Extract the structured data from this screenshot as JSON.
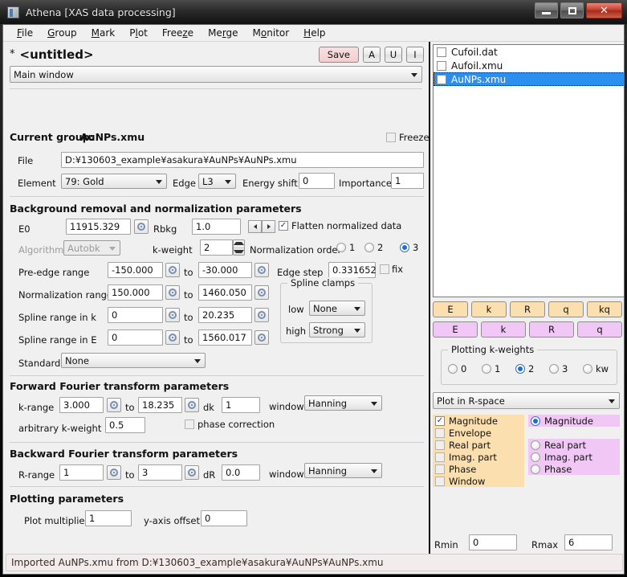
{
  "window": {
    "title": "Athena [XAS data processing]",
    "icon": "app-icon",
    "minimize": "–",
    "maximize": "□",
    "close": "✕"
  },
  "menubar": [
    {
      "label": "File"
    },
    {
      "label": "Group"
    },
    {
      "label": "Mark"
    },
    {
      "label": "Plot"
    },
    {
      "label": "Freeze"
    },
    {
      "label": "Merge"
    },
    {
      "label": "Monitor"
    },
    {
      "label": "Help"
    }
  ],
  "header": {
    "modified_marker": "*",
    "project_title": "<untitled>",
    "save_label": "Save",
    "a_label": "A",
    "u_label": "U",
    "i_label": "I",
    "view_combo": "Main window"
  },
  "current_group": {
    "label": "Current group:",
    "name": "AuNPs.xmu",
    "freeze_label": "Freeze",
    "freeze_checked": false,
    "file_label": "File",
    "file_value": "D:¥130603_example¥asakura¥AuNPs¥AuNPs.xmu",
    "element_label": "Element",
    "element_value": "79: Gold",
    "edge_label": "Edge",
    "edge_value": "L3",
    "energy_shift_label": "Energy shift",
    "energy_shift_value": "0",
    "importance_label": "Importance",
    "importance_value": "1"
  },
  "background": {
    "section_title": "Background removal and normalization parameters",
    "e0_label": "E0",
    "e0_value": "11915.329",
    "rbkg_label": "Rbkg",
    "rbkg_value": "1.0",
    "flatten_label": "Flatten normalized data",
    "flatten_checked": true,
    "algorithm_label": "Algorithm",
    "algorithm_value": "Autobk",
    "kweight_label": "k-weight",
    "kweight_value": "2",
    "norm_order_label": "Normalization order",
    "norm_order_options": [
      "1",
      "2",
      "3"
    ],
    "norm_order_selected": "3",
    "preedge_label": "Pre-edge range",
    "preedge_from": "-150.000",
    "preedge_to": "-30.000",
    "norm_label": "Normalization range",
    "norm_from": "150.000",
    "norm_to": "1460.050",
    "spline_k_label": "Spline range in k",
    "spline_k_from": "0",
    "spline_k_to": "20.235",
    "spline_e_label": "Spline range in E",
    "spline_e_from": "0",
    "spline_e_to": "1560.017",
    "to_label": "to",
    "edge_step_label": "Edge step",
    "edge_step_value": "0.331652",
    "fix_label": "fix",
    "fix_checked": false,
    "clamps_title": "Spline clamps",
    "clamp_low_label": "low",
    "clamp_low_value": "None",
    "clamp_high_label": "high",
    "clamp_high_value": "Strong",
    "standard_label": "Standard",
    "standard_value": "None"
  },
  "forward_ft": {
    "section_title": "Forward Fourier transform parameters",
    "krange_label": "k-range",
    "krange_from": "3.000",
    "krange_to": "18.235",
    "to_label": "to",
    "dk_label": "dk",
    "dk_value": "1",
    "window_label": "window",
    "window_value": "Hanning",
    "arb_kweight_label": "arbitrary k-weight",
    "arb_kweight_value": "0.5",
    "phase_correction_label": "phase correction",
    "phase_correction_checked": false
  },
  "backward_ft": {
    "section_title": "Backward Fourier transform parameters",
    "rrange_label": "R-range",
    "rrange_from": "1",
    "rrange_to": "3",
    "to_label": "to",
    "dr_label": "dR",
    "dr_value": "0.0",
    "window_label": "window",
    "window_value": "Hanning"
  },
  "plotting": {
    "section_title": "Plotting parameters",
    "multiplier_label": "Plot multiplier",
    "multiplier_value": "1",
    "offset_label": "y-axis offset",
    "offset_value": "0"
  },
  "group_list": [
    {
      "name": "Cufoil.dat",
      "checked": false,
      "selected": false
    },
    {
      "name": "Aufoil.xmu",
      "checked": false,
      "selected": false
    },
    {
      "name": "AuNPs.xmu",
      "checked": false,
      "selected": true
    }
  ],
  "plot_buttons": {
    "row_energy": [
      "E",
      "k",
      "R",
      "q",
      "kq"
    ],
    "row_marked": [
      "E",
      "k",
      "R",
      "q"
    ]
  },
  "plot_kweights": {
    "title": "Plotting k-weights",
    "options": [
      "0",
      "1",
      "2",
      "3",
      "kw"
    ],
    "selected": "2"
  },
  "plot_space_combo": "Plot in R-space",
  "r_space_options": {
    "left": [
      {
        "label": "Magnitude",
        "checked": true
      },
      {
        "label": "Envelope",
        "checked": false
      },
      {
        "label": "Real part",
        "checked": false
      },
      {
        "label": "Imag. part",
        "checked": false
      },
      {
        "label": "Phase",
        "checked": false
      },
      {
        "label": "Window",
        "checked": false
      }
    ],
    "right": [
      {
        "label": "Magnitude",
        "selected": true
      },
      {
        "label": "",
        "selected": false
      },
      {
        "label": "Real part",
        "selected": false
      },
      {
        "label": "Imag. part",
        "selected": false
      },
      {
        "label": "Phase",
        "selected": false
      }
    ]
  },
  "r_limits": {
    "rmin_label": "Rmin",
    "rmin_value": "0",
    "rmax_label": "Rmax",
    "rmax_value": "6"
  },
  "statusbar": {
    "message": "Imported AuNPs.xmu from D:¥130603_example¥asakura¥AuNPs¥AuNPs.xmu"
  },
  "colors": {
    "accent_selection": "#2a8fee",
    "energy_button": "#fbdfae",
    "marked_button": "#f0c7f5",
    "save_button": "#fae0e1"
  }
}
